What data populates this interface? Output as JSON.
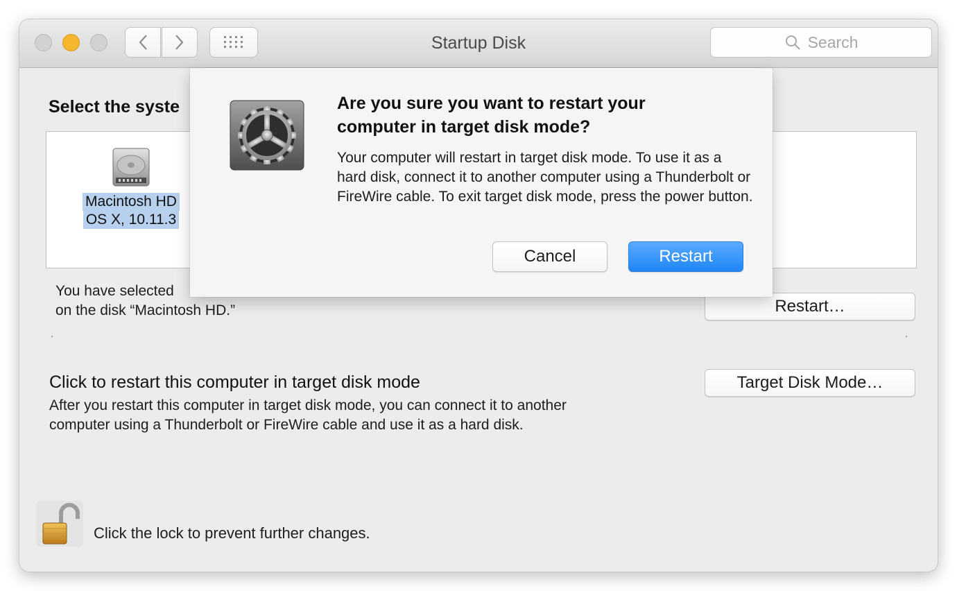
{
  "window": {
    "title": "Startup Disk",
    "search_placeholder": "Search",
    "icons": {
      "back": "chevron-left-icon",
      "forward": "chevron-right-icon",
      "grid": "grid-icon",
      "search": "search-icon"
    }
  },
  "main": {
    "section_title": "Select the syste",
    "disk": {
      "name": "Macintosh HD",
      "os": "OS X, 10.11.3",
      "icon": "hard-disk-icon"
    },
    "selected_text_line1": "You have selected",
    "selected_text_line2": "on the disk “Macintosh HD.”",
    "restart_button": "Restart…",
    "target_disk": {
      "title": "Click to restart this computer in target disk mode",
      "description": "After you restart this computer in target disk mode, you can connect it to another computer using a Thunderbolt or FireWire cable and use it as a hard disk.",
      "button": "Target Disk Mode…"
    },
    "lock": {
      "text": "Click the lock to prevent further changes.",
      "icon": "unlocked-padlock-icon"
    }
  },
  "dialog": {
    "icon": "system-preferences-gear-icon",
    "title": "Are you sure you want to restart your computer in target disk mode?",
    "message": "Your computer will restart in target disk mode. To use it as a hard disk, connect it to another computer using a Thunderbolt or FireWire cable. To exit target disk mode, press the power button.",
    "cancel_label": "Cancel",
    "confirm_label": "Restart"
  },
  "colors": {
    "accent": "#1f86f5",
    "selection": "#b7d0ed",
    "minimize": "#f5b630"
  }
}
